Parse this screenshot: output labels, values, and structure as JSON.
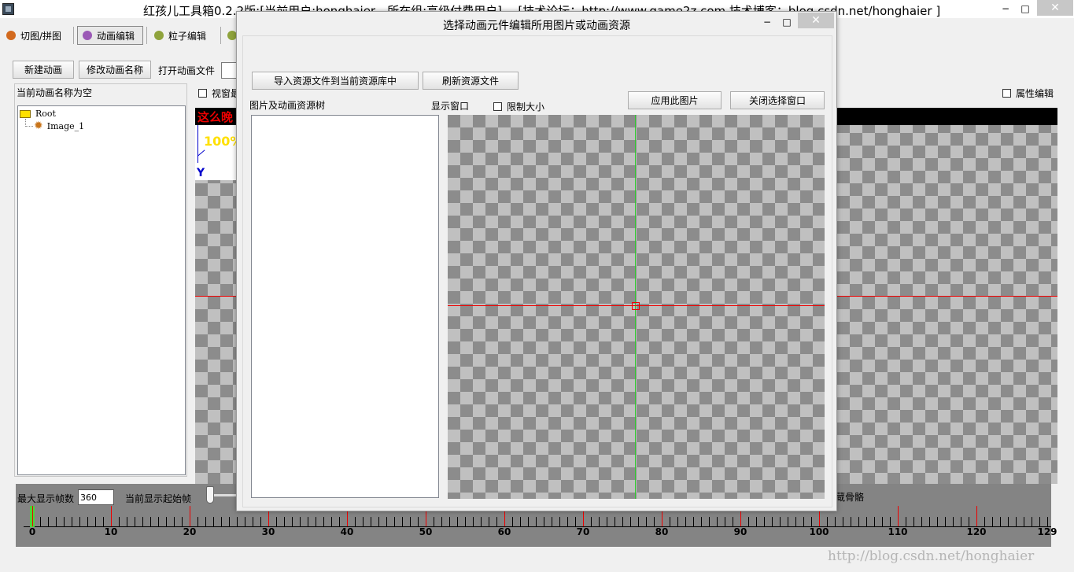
{
  "titlebar": {
    "title": "红孩儿工具箱0.2.2版:[当前用户:honghaier，所在组:高级付费用户] -- [技术论坛：http://www.game2z.com 技术博客：blog.csdn.net/honghaier ]",
    "minimize": "−",
    "maximize": "□",
    "close": "✕"
  },
  "toolbar": {
    "tabs": [
      {
        "label": "切图/拼图",
        "icon": "cut-icon",
        "color": "#d2691e"
      },
      {
        "label": "动画编辑",
        "icon": "animation-icon",
        "color": "#9b59b6"
      },
      {
        "label": "粒子编辑",
        "icon": "particle-icon",
        "color": "#8fa33c"
      }
    ]
  },
  "left": {
    "new_anim": "新建动画",
    "rename_anim": "修改动画名称",
    "open_anim": "打开动画文件",
    "current_name": "当前动画名称为空",
    "tree": {
      "root": "Root",
      "child": "Image_1"
    },
    "viewport_checkbox": "视窗最"
  },
  "right": {
    "attr_edit": "属性编辑"
  },
  "canvas": {
    "banner": "这么晚",
    "zoom": "100%",
    "axis_y": "Y"
  },
  "bottom": {
    "max_frames_label": "最大显示帧数",
    "max_frames_value": "360",
    "start_frame_label": "当前显示起始帧",
    "bone_label": "蔵骨骼",
    "ruler_labels": [
      "0",
      "10",
      "20",
      "30",
      "40",
      "50",
      "60",
      "70",
      "80",
      "90",
      "100",
      "110",
      "120",
      "129"
    ]
  },
  "dialog": {
    "title": "选择动画元件编辑所用图片或动画资源",
    "minimize": "−",
    "maximize": "□",
    "close": "✕",
    "import_btn": "导入资源文件到当前资源库中",
    "refresh_btn": "刷新资源文件",
    "tree_label": "图片及动画资源树",
    "display_label": "显示窗口",
    "limit_size": "限制大小",
    "apply_btn": "应用此图片",
    "close_btn": "关闭选择窗口"
  },
  "watermark": "http://blog.csdn.net/honghaier"
}
